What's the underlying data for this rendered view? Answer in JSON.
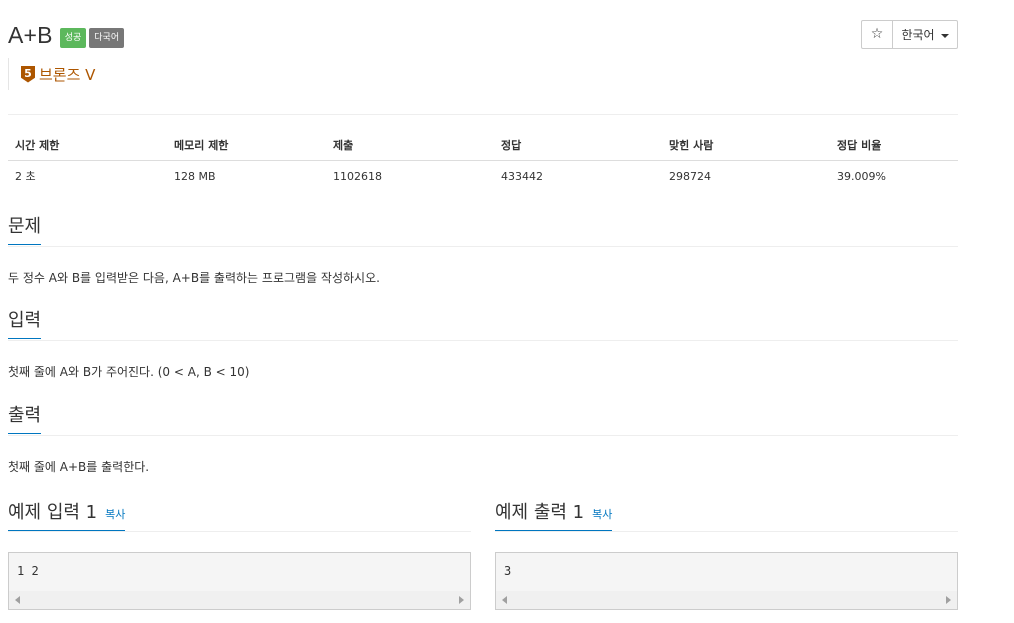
{
  "problem": {
    "title": "A+B",
    "badges": {
      "success": "성공",
      "multilang": "다국어"
    },
    "tier": {
      "level": "5",
      "label": "브론즈 V",
      "color": "#ad5600"
    }
  },
  "toolbar": {
    "star_icon": "☆",
    "language": "한국어"
  },
  "info_table": {
    "headers": [
      "시간 제한",
      "메모리 제한",
      "제출",
      "정답",
      "맞힌 사람",
      "정답 비율"
    ],
    "values": [
      "2 초",
      "128 MB",
      "1102618",
      "433442",
      "298724",
      "39.009%"
    ]
  },
  "sections": {
    "problem": {
      "title": "문제",
      "body": "두 정수 A와 B를 입력받은 다음, A+B를 출력하는 프로그램을 작성하시오."
    },
    "input": {
      "title": "입력",
      "body": "첫째 줄에 A와 B가 주어진다. (0 < A, B < 10)"
    },
    "output": {
      "title": "출력",
      "body": "첫째 줄에 A+B를 출력한다."
    }
  },
  "samples": {
    "input": {
      "title": "예제 입력 1",
      "copy": "복사",
      "content": "1 2"
    },
    "output": {
      "title": "예제 출력 1",
      "copy": "복사",
      "content": "3"
    }
  },
  "colors": {
    "accent": "#0076c0",
    "success": "#5cb85c",
    "multilang": "#777777"
  }
}
